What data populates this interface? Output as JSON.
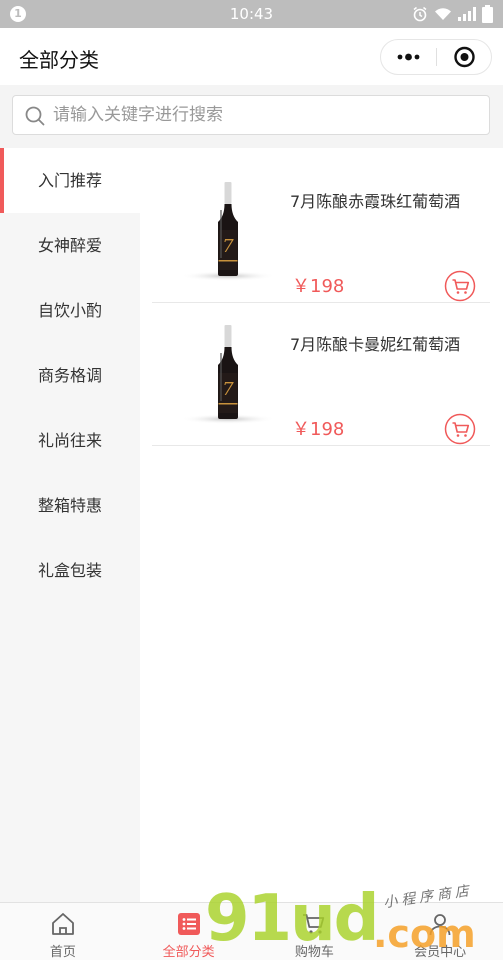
{
  "status_bar": {
    "notification_count": "1",
    "time": "10:43",
    "icons": [
      "alarm-icon",
      "wifi-icon",
      "signal-icon",
      "battery-icon"
    ]
  },
  "nav": {
    "title": "全部分类",
    "icons": [
      "more-icon",
      "close-target-icon"
    ]
  },
  "search": {
    "placeholder": "请输入关键字进行搜索",
    "value": ""
  },
  "sidebar": {
    "active_index": 0,
    "items": [
      {
        "label": "入门推荐"
      },
      {
        "label": "女神醉爱"
      },
      {
        "label": "自饮小酌"
      },
      {
        "label": "商务格调"
      },
      {
        "label": "礼尚往来"
      },
      {
        "label": "整箱特惠"
      },
      {
        "label": "礼盒包装"
      }
    ]
  },
  "products": [
    {
      "name": "7月陈酿赤霞珠红葡萄酒",
      "price": "￥198"
    },
    {
      "name": "7月陈酿卡曼妮红葡萄酒",
      "price": "￥198"
    }
  ],
  "tabs": [
    {
      "label": "首页",
      "icon": "home-icon"
    },
    {
      "label": "全部分类",
      "icon": "list-icon"
    },
    {
      "label": "购物车",
      "icon": "cart-icon"
    },
    {
      "label": "会员中心",
      "icon": "user-icon"
    }
  ],
  "active_tab": 1,
  "watermark": {
    "brand": "91ud",
    "domain": ".com",
    "tagline": "小程序商店"
  },
  "colors": {
    "accent": "#f05a5a",
    "status_bar": "#bdbdbd",
    "sidebar_bg": "#f6f6f6",
    "search_bg": "#f4f4f4"
  }
}
